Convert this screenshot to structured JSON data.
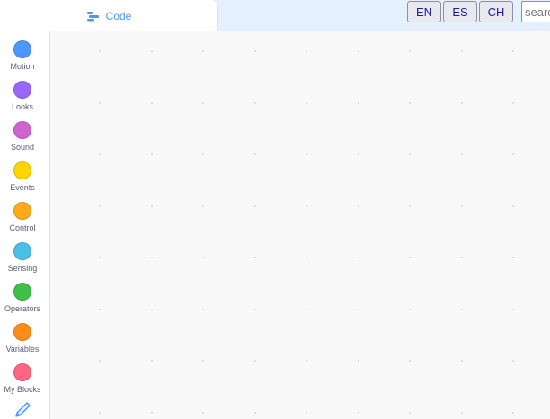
{
  "tabs": {
    "code_label": "Code"
  },
  "languages": [
    "EN",
    "ES",
    "CH"
  ],
  "search": {
    "placeholder": "search"
  },
  "categories": [
    {
      "label": "Motion",
      "color": "#4c97ff",
      "icon": "motion-dot"
    },
    {
      "label": "Looks",
      "color": "#9966ff",
      "icon": "looks-dot"
    },
    {
      "label": "Sound",
      "color": "#cf63cf",
      "icon": "sound-dot"
    },
    {
      "label": "Events",
      "color": "#ffd500",
      "icon": "events-dot"
    },
    {
      "label": "Control",
      "color": "#ffab19",
      "icon": "control-dot"
    },
    {
      "label": "Sensing",
      "color": "#4cbfe6",
      "icon": "sensing-dot"
    },
    {
      "label": "Operators",
      "color": "#40bf4a",
      "icon": "operators-dot"
    },
    {
      "label": "Variables",
      "color": "#ff8c1a",
      "icon": "variables-dot"
    },
    {
      "label": "My Blocks",
      "color": "#ff6680",
      "icon": "my-blocks-dot"
    }
  ],
  "extension_icon": "pen-extension-icon",
  "colors": {
    "accent": "#4c97ff",
    "header_bg": "#e5f0ff"
  }
}
